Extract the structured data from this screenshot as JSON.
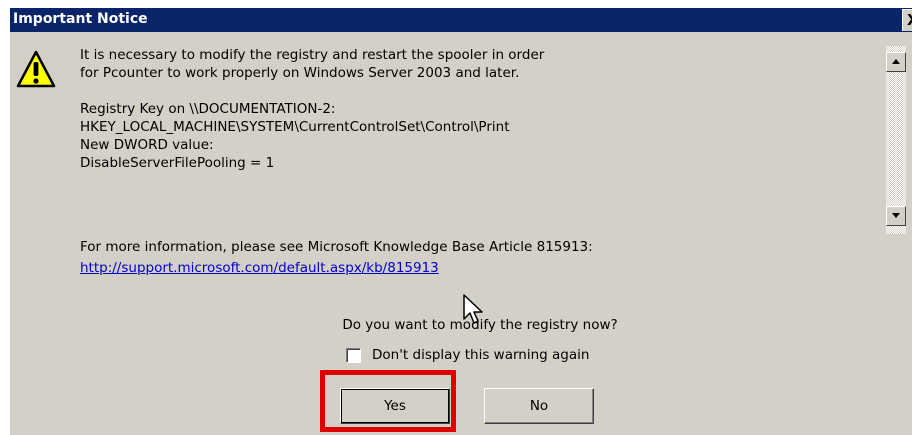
{
  "window": {
    "title": "Important Notice",
    "close_label": "X"
  },
  "icons": {
    "warning": "warning-icon",
    "scroll_up": "scroll-up-arrow-icon",
    "scroll_down": "scroll-down-arrow-icon",
    "cursor": "mouse-pointer-icon"
  },
  "message": {
    "lines": [
      "It is necessary to modify the registry and restart the spooler in order",
      "for Pcounter to work properly on Windows Server 2003 and later.",
      "Registry Key on \\\\DOCUMENTATION-2:",
      "HKEY_LOCAL_MACHINE\\SYSTEM\\CurrentControlSet\\Control\\Print",
      "New DWORD value:",
      "DisableServerFilePooling = 1"
    ]
  },
  "more_info": {
    "intro": "For more information, please see Microsoft Knowledge Base Article 815913:",
    "link": "http://support.microsoft.com/default.aspx/kb/815913"
  },
  "question": "Do you want to modify the registry now?",
  "checkbox": {
    "label": "Don't display this warning again",
    "checked": false
  },
  "buttons": {
    "yes": "Yes",
    "no": "No"
  },
  "colors": {
    "titlebar": "#0a246a",
    "dialog_bg": "#d4d0c8",
    "link": "#0000cc",
    "highlight": "#e00000"
  }
}
